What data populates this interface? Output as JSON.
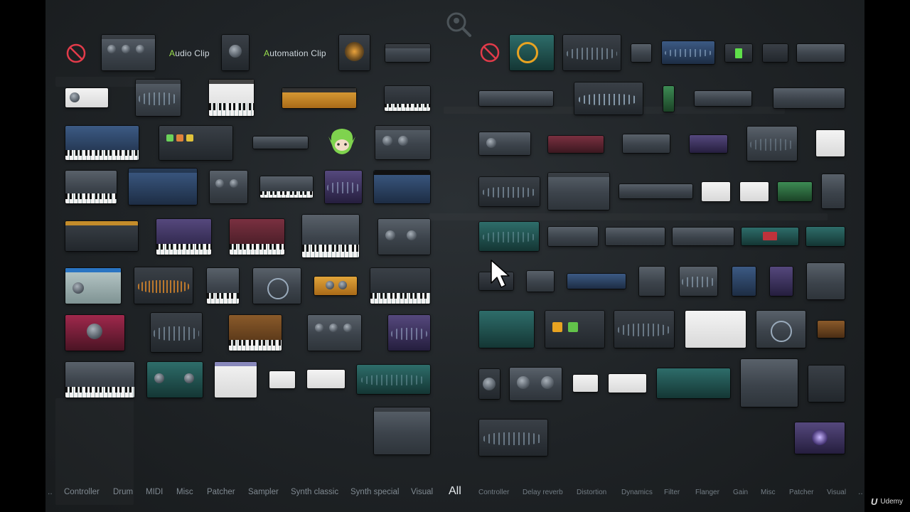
{
  "labels": {
    "audio_clip_accent": "A",
    "audio_clip_rest": "udio Clip",
    "automation_clip_accent": "A",
    "automation_clip_rest": "utomation Clip"
  },
  "categories": [
    {
      "label": "Controller",
      "active": false
    },
    {
      "label": "Drum",
      "active": false
    },
    {
      "label": "MIDI",
      "active": false
    },
    {
      "label": "Misc",
      "active": false
    },
    {
      "label": "Patcher",
      "active": false
    },
    {
      "label": "Sampler",
      "active": false
    },
    {
      "label": "Synth classic",
      "active": false
    },
    {
      "label": "Synth special",
      "active": false
    },
    {
      "label": "Visual",
      "active": false
    },
    {
      "label": "All",
      "active": true
    },
    {
      "label": "Controller",
      "active": false
    },
    {
      "label": "Delay reverb",
      "active": false
    },
    {
      "label": "Distortion",
      "active": false
    },
    {
      "label": "Dynamics",
      "active": false
    },
    {
      "label": "Filter",
      "active": false
    },
    {
      "label": "Flanger",
      "active": false
    },
    {
      "label": "Gain",
      "active": false
    },
    {
      "label": "Misc",
      "active": false
    },
    {
      "label": "Patcher",
      "active": false
    },
    {
      "label": "Visual",
      "active": false
    }
  ],
  "overflow_left": "..",
  "overflow_right": "..",
  "watermark": {
    "logo": "U",
    "text": "Udemy"
  },
  "icons": {
    "search": "search-icon",
    "none_generators": "none-icon",
    "none_effects": "none-icon",
    "cursor": "mouse-pointer-icon"
  },
  "colors": {
    "accent_green": "#9ae04d",
    "none_red": "#e23b4a",
    "active_category": "#e7ecef",
    "inactive_category": "#808a92"
  }
}
